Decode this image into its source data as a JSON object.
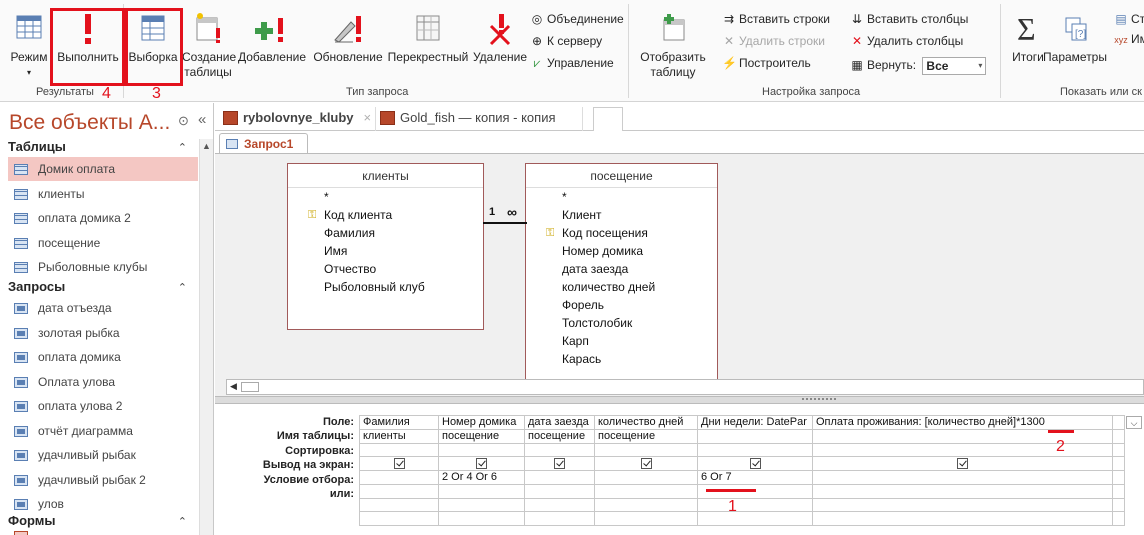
{
  "ribbon": {
    "buttons": {
      "mode": "Режим",
      "run": "Выполнить",
      "select": "Выборка",
      "make_table_1": "Создание",
      "make_table_2": "таблицы",
      "append": "Добавление",
      "update": "Обновление",
      "crosstab": "Перекрестный",
      "delete": "Удаление",
      "show_table_1": "Отобразить",
      "show_table_2": "таблицу",
      "totals": "Итоги",
      "params": "Параметры"
    },
    "small": {
      "union": "Объединение",
      "server": "К серверу",
      "manage": "Управление",
      "insert_rows": "Вставить строки",
      "delete_rows": "Удалить строки",
      "builder": "Построитель",
      "insert_cols": "Вставить столбцы",
      "delete_cols": "Удалить столбцы",
      "return_label": "Вернуть:",
      "return_value": "Все",
      "right_cut_1": "Ст",
      "right_cut_2": "Им"
    },
    "groups": {
      "results": "Результаты",
      "query_type": "Тип запроса",
      "setup": "Настройка запроса",
      "show_hide": "Показать или ск"
    },
    "annotations": {
      "a4": "4",
      "a3": "3",
      "a2": "2",
      "a1": "1"
    }
  },
  "nav": {
    "title": "Все объекты А...",
    "sections": {
      "tables": "Таблицы",
      "queries": "Запросы",
      "forms": "Формы"
    },
    "tables": [
      "Домик оплата",
      "клиенты",
      "оплата домика 2",
      "посещение",
      "Рыболовные клубы"
    ],
    "queries": [
      "дата отъезда",
      "золотая рыбка",
      "оплата домика",
      "Оплата улова",
      "оплата улова 2",
      "отчёт диаграмма",
      "удачливый рыбак",
      "удачливый рыбак 2",
      "улов"
    ]
  },
  "tabs": {
    "active": "rybolovnye_kluby",
    "active_close": "×",
    "inactive": "Gold_fish — копия - копия"
  },
  "query_tab": "Запрос1",
  "tables_view": {
    "clients": {
      "title": "клиенты",
      "fields": [
        "*",
        "Код клиента",
        "Фамилия",
        "Имя",
        "Отчество",
        "Рыболовный клуб"
      ]
    },
    "visits": {
      "title": "посещение",
      "fields": [
        "*",
        "Клиент",
        "Код посещения",
        "Номер домика",
        "дата заезда",
        "количество дней",
        "Форель",
        "Толстолобик",
        "Карп",
        "Карась"
      ]
    },
    "relation_one": "1",
    "relation_many": "∞"
  },
  "grid": {
    "row_labels": [
      "Поле:",
      "Имя таблицы:",
      "Сортировка:",
      "Вывод на экран:",
      "Условие отбора:",
      "или:"
    ],
    "columns": [
      {
        "field": "Фамилия",
        "table": "клиенты",
        "criteria": ""
      },
      {
        "field": "Номер домика",
        "table": "посещение",
        "criteria": "2 Or 4 Or 6"
      },
      {
        "field": "дата заезда",
        "table": "посещение",
        "criteria": ""
      },
      {
        "field": "количество дней",
        "table": "посещение",
        "criteria": ""
      },
      {
        "field": "Дни недели: DatePar",
        "table": "",
        "criteria": "6 Or 7"
      },
      {
        "field": "Оплата проживания: [количество дней]*1300",
        "table": "",
        "criteria": ""
      }
    ]
  },
  "colors": {
    "accent": "#b7472a",
    "annotation": "#e3111c",
    "selected": "#f4c7c3"
  }
}
